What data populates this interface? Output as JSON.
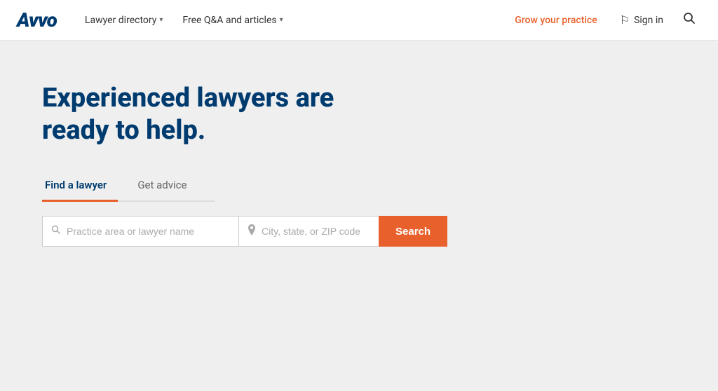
{
  "header": {
    "logo": "Avvo",
    "nav": {
      "lawyer_directory": "Lawyer directory",
      "qa_articles": "Free Q&A and articles"
    },
    "grow_practice": "Grow your practice",
    "sign_in": "Sign in"
  },
  "hero": {
    "title": "Experienced lawyers are ready to help.",
    "tabs": [
      {
        "id": "find-lawyer",
        "label": "Find a lawyer",
        "active": true
      },
      {
        "id": "get-advice",
        "label": "Get advice",
        "active": false
      }
    ],
    "search": {
      "practice_placeholder": "Practice area or lawyer name",
      "location_placeholder": "City, state, or ZIP code",
      "button_label": "Search"
    }
  }
}
